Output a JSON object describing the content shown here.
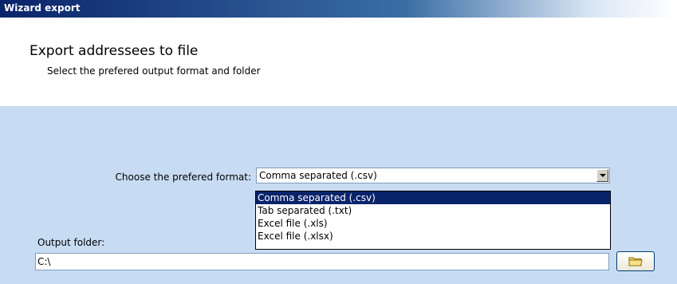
{
  "window": {
    "title": "Wizard export"
  },
  "header": {
    "heading": "Export addressees to file",
    "subheading": "Select the prefered output format and folder"
  },
  "format": {
    "label": "Choose the prefered format:",
    "selected": "Comma separated (.csv)",
    "options": [
      "Comma separated (.csv)",
      "Tab separated (.txt)",
      "Excel file (.xls)",
      "Excel file (.xlsx)"
    ]
  },
  "output": {
    "label": "Output folder:",
    "value": "C:\\",
    "browse_icon": "folder-icon"
  },
  "colors": {
    "title_bar": "#0a246a",
    "content_background": "#c7dcf3",
    "selection": "#0a246a"
  }
}
